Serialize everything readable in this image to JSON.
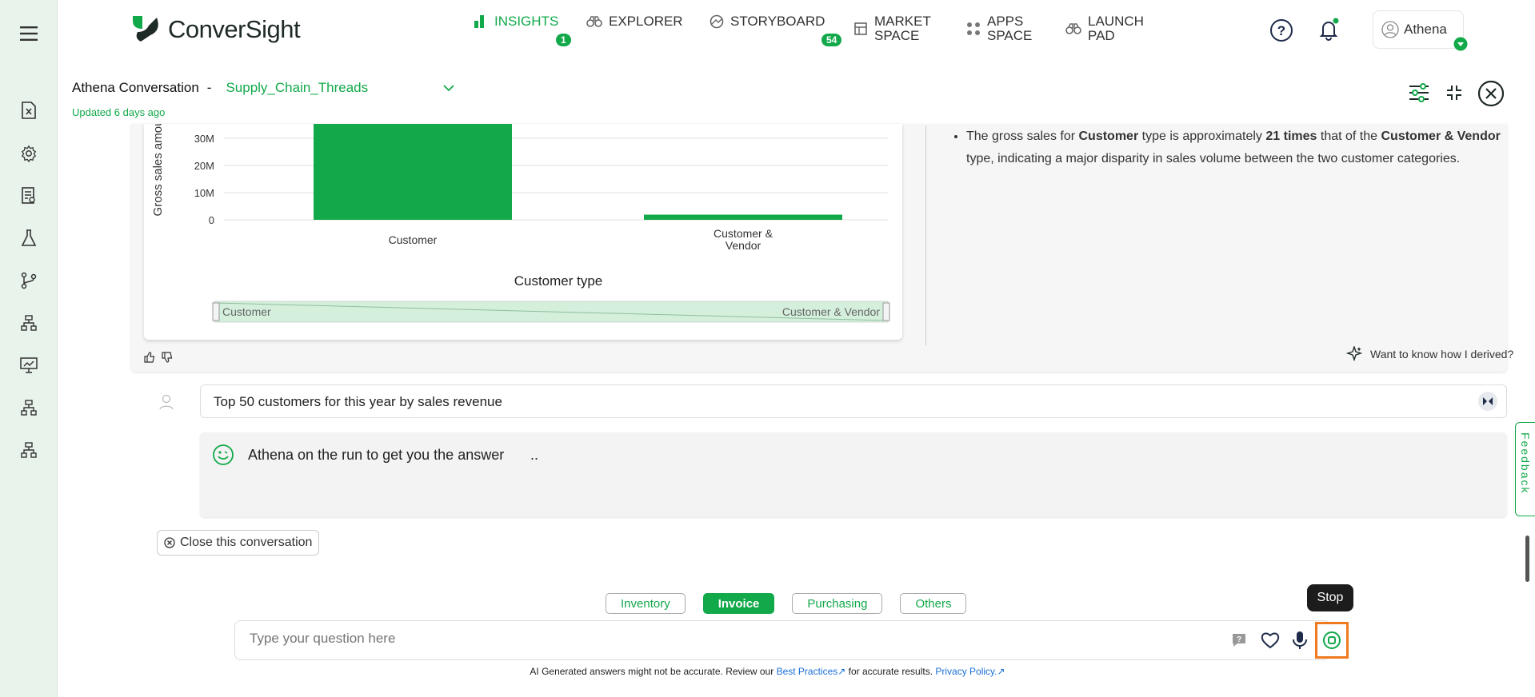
{
  "topbar": {
    "logo_text": "ConverSight",
    "nav": [
      {
        "label": "INSIGHTS",
        "badge": "1"
      },
      {
        "label": "EXPLORER"
      },
      {
        "label": "STORYBOARD",
        "badge": "54"
      },
      {
        "label_line1": "MARKET",
        "label_line2": "SPACE"
      },
      {
        "label_line1": "APPS",
        "label_line2": "SPACE"
      },
      {
        "label_line1": "LAUNCH",
        "label_line2": "PAD"
      }
    ],
    "user_name": "Athena"
  },
  "conversation": {
    "title": "Athena Conversation",
    "separator": "-",
    "dataset": "Supply_Chain_Threads",
    "updated": "Updated 6 days ago"
  },
  "chart_data": {
    "type": "bar",
    "categories": [
      "Customer",
      "Customer & Vendor"
    ],
    "values": [
      39500000,
      1900000
    ],
    "xlabel": "Customer type",
    "ylabel": "Gross sales amou",
    "yticks": [
      "0",
      "10M",
      "20M",
      "30M"
    ],
    "ylim": [
      0,
      37000000
    ],
    "grid": true,
    "bar_color": "#12a94a",
    "slider_labels": [
      "Customer",
      "Customer & Vendor"
    ]
  },
  "insight": {
    "text_1": "The gross sales for ",
    "bold_1": "Customer",
    "text_2": " type is approximately ",
    "bold_2": "21 times",
    "text_3": " that of the ",
    "bold_3": "Customer & Vendor",
    "text_4": " type, indicating a major disparity in sales volume between the two customer categories.",
    "derive_link": "Want to know how I derived?"
  },
  "question": {
    "text": "Top 50 customers for this year by sales revenue"
  },
  "answer": {
    "status": "Athena on the run to get you the answer"
  },
  "close_conversation": "Close this conversation",
  "chips": [
    {
      "label": "Inventory",
      "active": false
    },
    {
      "label": "Invoice",
      "active": true
    },
    {
      "label": "Purchasing",
      "active": false
    },
    {
      "label": "Others",
      "active": false
    }
  ],
  "input": {
    "placeholder": "Type your question here"
  },
  "tooltip": "Stop",
  "disclaimer": {
    "prefix": "AI Generated answers might not be accurate. Review our ",
    "best_practices": "Best Practices",
    "middle": " for accurate results. ",
    "privacy": "Privacy Policy."
  },
  "feedback": "Feedback",
  "colors": {
    "accent": "#12a94a",
    "highlight": "#f07a20"
  }
}
